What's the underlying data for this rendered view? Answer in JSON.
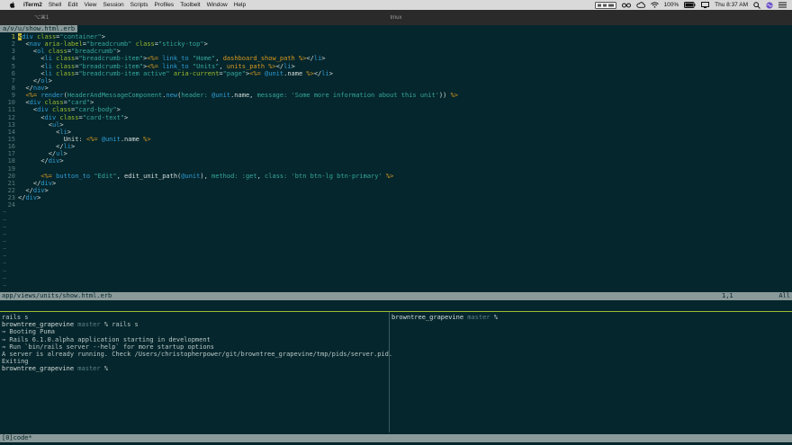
{
  "menubar": {
    "items": [
      "iTerm2",
      "Shell",
      "Edit",
      "View",
      "Session",
      "Scripts",
      "Profiles",
      "Toolbelt",
      "Window",
      "Help"
    ],
    "battery": "100%",
    "clock": "Thu 8:37 AM",
    "icons": [
      "apple-icon",
      "status-box-icon",
      "glasses-icon",
      "cloud-icon",
      "wifi-icon",
      "battery-icon",
      "display-icon",
      "search-icon",
      "siri-icon",
      "list-icon"
    ]
  },
  "window": {
    "shortcut": "⌥⌘1",
    "title": "tmux"
  },
  "vim": {
    "tab_label": "a/v/u/show.html.erb",
    "code_lines": [
      {
        "n": "1",
        "html": "<span class=\"cursor\">&lt;</span><span class=\"t-tag\">div</span> <span class=\"t-attr\">class</span>=<span class=\"t-str\">\"container\"</span>&gt;"
      },
      {
        "n": "2",
        "html": "  &lt;<span class=\"t-tag\">nav</span> <span class=\"t-attr\">aria-label</span>=<span class=\"t-str\">\"breadcrumb\"</span> <span class=\"t-attr\">class</span>=<span class=\"t-str\">\"sticky-top\"</span>&gt;"
      },
      {
        "n": "3",
        "html": "    &lt;<span class=\"t-tag\">ol</span> <span class=\"t-attr\">class</span>=<span class=\"t-str\">\"breadcrumb\"</span>&gt;"
      },
      {
        "n": "4",
        "html": "      &lt;<span class=\"t-tag\">li</span> <span class=\"t-attr\">class</span>=<span class=\"t-str\">\"breadcrumb-item\"</span>&gt;<span class=\"t-erb\">&lt;%=</span> <span class=\"t-kw\">link_to</span> <span class=\"t-str\">\"Home\"</span>, <span class=\"t-erb\">dashboard_show_path</span> <span class=\"t-erb\">%&gt;</span>&lt;/<span class=\"t-tag\">li</span>&gt;"
      },
      {
        "n": "5",
        "html": "      &lt;<span class=\"t-tag\">li</span> <span class=\"t-attr\">class</span>=<span class=\"t-str\">\"breadcrumb-item\"</span>&gt;<span class=\"t-erb\">&lt;%=</span> <span class=\"t-kw\">link_to</span> <span class=\"t-str\">\"Units\"</span>, <span class=\"t-erb\">units_path</span> <span class=\"t-erb\">%&gt;</span>&lt;/<span class=\"t-tag\">li</span>&gt;"
      },
      {
        "n": "6",
        "html": "      &lt;<span class=\"t-tag\">li</span> <span class=\"t-attr\">class</span>=<span class=\"t-str\">\"breadcrumb-item active\"</span> <span class=\"t-attr\">aria-current</span>=<span class=\"t-str\">\"page\"</span>&gt;<span class=\"t-erb\">&lt;%=</span> <span class=\"t-ivar\">@unit</span>.name <span class=\"t-erb\">%&gt;</span>&lt;/<span class=\"t-tag\">li</span>&gt;"
      },
      {
        "n": "7",
        "html": "    &lt;/<span class=\"t-tag\">ol</span>&gt;"
      },
      {
        "n": "8",
        "html": "  &lt;/<span class=\"t-tag\">nav</span>&gt;"
      },
      {
        "n": "9",
        "html": "  <span class=\"t-erb\">&lt;%=</span> <span class=\"t-kw\">render</span>(<span class=\"t-str\">HeaderAndMessageComponent</span>.<span class=\"t-kw\">new</span>(<span class=\"t-sym\">header:</span> <span class=\"t-ivar\">@unit</span>.name, <span class=\"t-sym\">message:</span> <span class=\"t-str\">'Some more information about this unit'</span>)) <span class=\"t-erb\">%&gt;</span>"
      },
      {
        "n": "10",
        "html": "  &lt;<span class=\"t-tag\">div</span> <span class=\"t-attr\">class</span>=<span class=\"t-str\">\"card\"</span>&gt;"
      },
      {
        "n": "11",
        "html": "    &lt;<span class=\"t-tag\">div</span> <span class=\"t-attr\">class</span>=<span class=\"t-str\">\"card-body\"</span>&gt;"
      },
      {
        "n": "12",
        "html": "      &lt;<span class=\"t-tag\">div</span> <span class=\"t-attr\">class</span>=<span class=\"t-str\">\"card-text\"</span>&gt;"
      },
      {
        "n": "13",
        "html": "        &lt;<span class=\"t-tag\">ul</span>&gt;"
      },
      {
        "n": "14",
        "html": "          &lt;<span class=\"t-tag\">li</span>&gt;"
      },
      {
        "n": "15",
        "html": "            Unit: <span class=\"t-erb\">&lt;%=</span> <span class=\"t-ivar\">@unit</span>.name <span class=\"t-erb\">%&gt;</span>"
      },
      {
        "n": "16",
        "html": "          &lt;/<span class=\"t-tag\">li</span>&gt;"
      },
      {
        "n": "17",
        "html": "        &lt;/<span class=\"t-tag\">ul</span>&gt;"
      },
      {
        "n": "18",
        "html": "      &lt;/<span class=\"t-tag\">div</span>&gt;"
      },
      {
        "n": "19",
        "html": ""
      },
      {
        "n": "20",
        "html": "      <span class=\"t-erb\">&lt;%=</span> <span class=\"t-kw\">button_to</span> <span class=\"t-str\">\"Edit\"</span>, edit_unit_path(<span class=\"t-ivar\">@unit</span>), <span class=\"t-sym\">method:</span> <span class=\"t-sym\">:get</span>, <span class=\"t-sym\">class:</span> <span class=\"t-str\">'btn btn-lg btn-primary'</span> <span class=\"t-erb\">%&gt;</span>"
      },
      {
        "n": "21",
        "html": "    &lt;/<span class=\"t-tag\">div</span>&gt;"
      },
      {
        "n": "22",
        "html": "  &lt;/<span class=\"t-tag\">div</span>&gt;"
      },
      {
        "n": "23",
        "html": "&lt;/<span class=\"t-tag\">div</span>&gt;"
      },
      {
        "n": "24",
        "html": ""
      }
    ],
    "tilde": "~",
    "tilde_count": 11,
    "status_file": "app/views/units/show.html.erb",
    "status_pos": "1,1",
    "status_all": "All"
  },
  "terminal_left": {
    "lines": [
      {
        "type": "plain",
        "text": "rails s"
      },
      {
        "type": "prompt",
        "host": "browntree_grapevine",
        "branch": "master",
        "cmd": "% rails s"
      },
      {
        "type": "plain",
        "text": "⇒ Booting Puma"
      },
      {
        "type": "plain",
        "text": "⇒ Rails 6.1.0.alpha application starting in development"
      },
      {
        "type": "plain",
        "text": "⇒ Run `bin/rails server --help` for more startup options"
      },
      {
        "type": "plain",
        "text": "A server is already running. Check /Users/christopherpower/git/browntree_grapevine/tmp/pids/server.pid."
      },
      {
        "type": "plain",
        "text": "Exiting"
      },
      {
        "type": "prompt",
        "host": "browntree_grapevine",
        "branch": "master",
        "cmd": "%"
      }
    ]
  },
  "terminal_right": {
    "host": "browntree_grapevine",
    "branch": "master",
    "cmd": "%"
  },
  "tmux": {
    "status": "[0]code*"
  }
}
